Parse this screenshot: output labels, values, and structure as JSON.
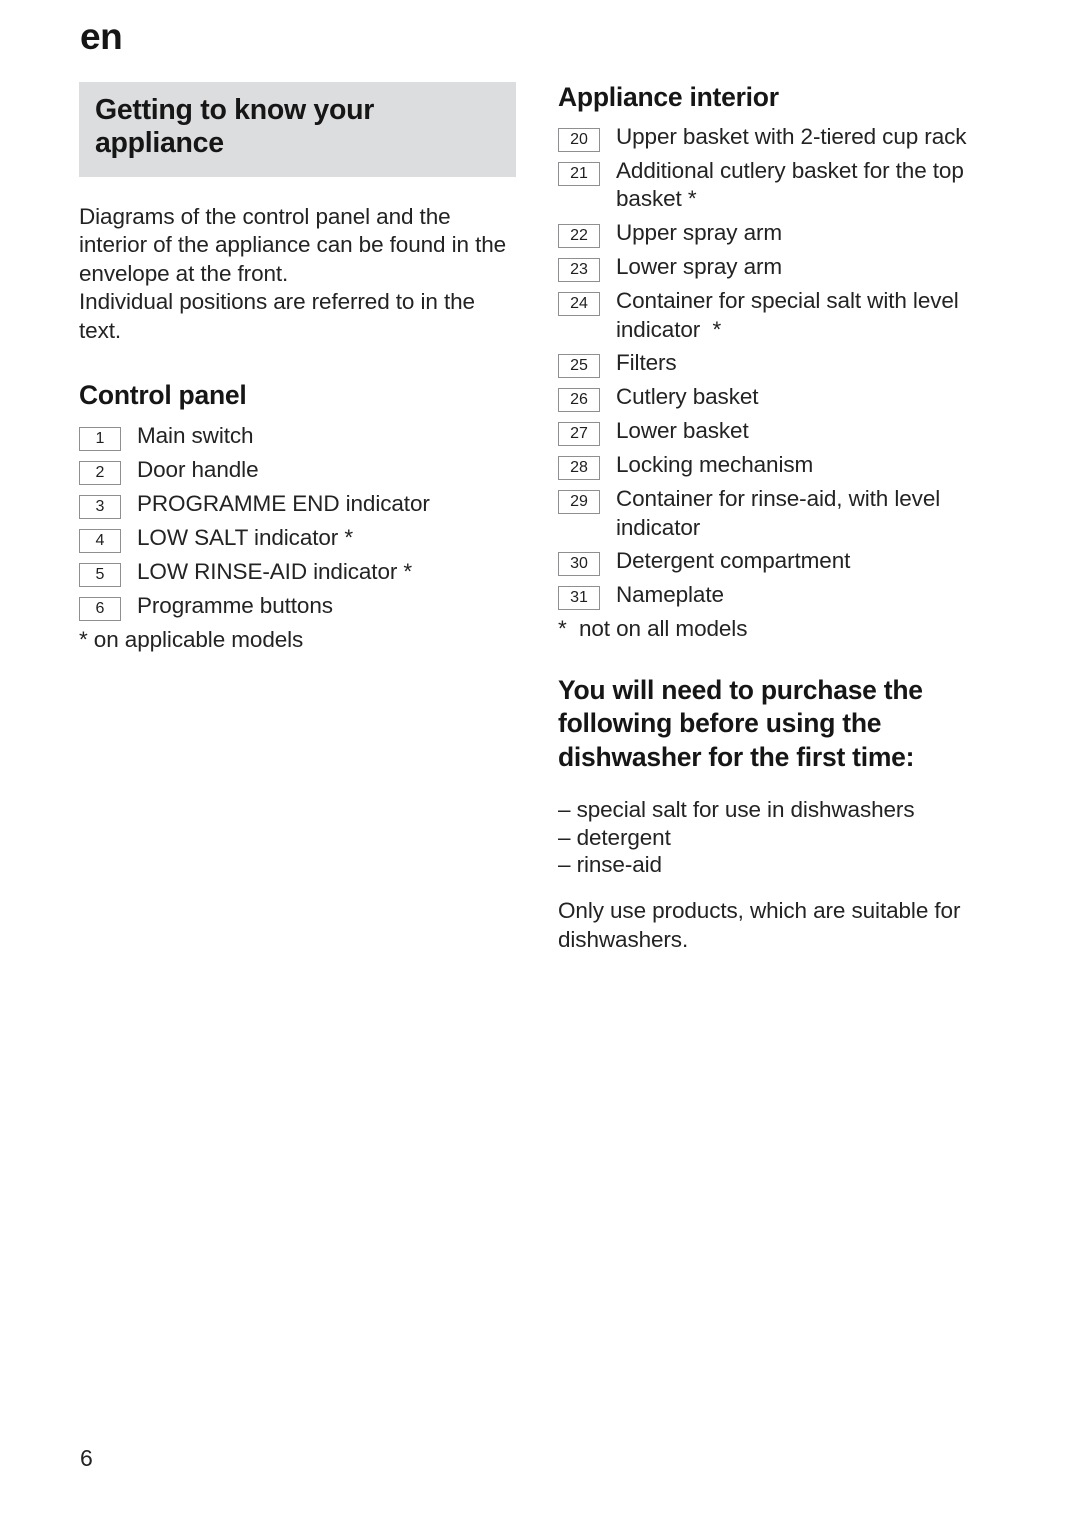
{
  "running_head": {
    "language": "en"
  },
  "chapter": {
    "title": "Getting to know your appliance",
    "band_color": "#dcdddf"
  },
  "left_column": {
    "intro_paragraph_1": "Diagrams of the control panel and the interior of the appliance can be found in the envelope at the front.",
    "intro_paragraph_2": "Individual positions are referred to in the text.",
    "control_panel": {
      "heading": "Control panel",
      "items": [
        {
          "number": "1",
          "label": "Main switch"
        },
        {
          "number": "2",
          "label": "Door handle"
        },
        {
          "number": "3",
          "label": "PROGRAMME END indicator"
        },
        {
          "number": "4",
          "label": "LOW SALT indicator *"
        },
        {
          "number": "5",
          "label": "LOW RINSE-AID indicator *"
        },
        {
          "number": "6",
          "label": "Programme buttons"
        }
      ],
      "footnote": "* on applicable models"
    }
  },
  "right_column": {
    "appliance_interior": {
      "heading": "Appliance interior",
      "items": [
        {
          "number": "20",
          "label": "Upper basket with 2-tiered cup rack"
        },
        {
          "number": "21",
          "label": "Additional cutlery basket for the top basket *"
        },
        {
          "number": "22",
          "label": "Upper spray arm"
        },
        {
          "number": "23",
          "label": "Lower spray arm"
        },
        {
          "number": "24",
          "label": "Container for special salt with level indicator  *"
        },
        {
          "number": "25",
          "label": "Filters"
        },
        {
          "number": "26",
          "label": "Cutlery basket"
        },
        {
          "number": "27",
          "label": "Lower basket"
        },
        {
          "number": "28",
          "label": "Locking mechanism"
        },
        {
          "number": "29",
          "label": "Container for rinse-aid, with level indicator"
        },
        {
          "number": "30",
          "label": "Detergent compartment"
        },
        {
          "number": "31",
          "label": "Nameplate"
        }
      ],
      "footnote": "*  not on all models"
    },
    "purchase_section": {
      "heading": "You will need to purchase the following before using the dishwasher for the first time:",
      "items": [
        "– special salt for use in dishwashers",
        "– detergent",
        "– rinse-aid"
      ],
      "closing_paragraph": "Only use products, which are suitable for dishwashers."
    }
  },
  "folio": {
    "page_number": "6"
  }
}
